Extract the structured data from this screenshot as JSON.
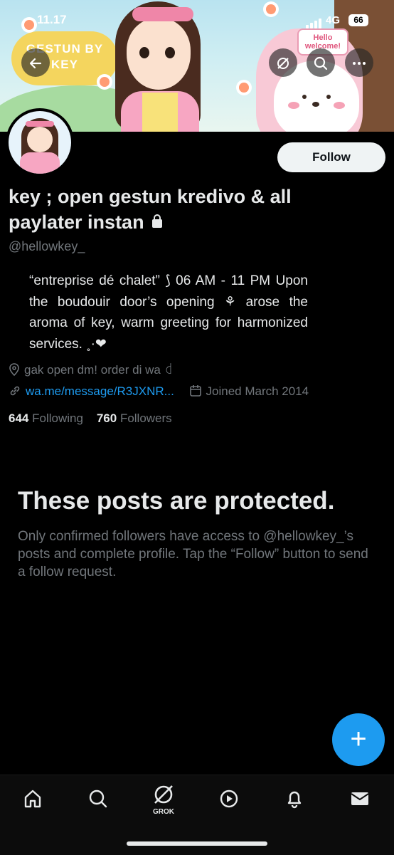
{
  "status_bar": {
    "time": "11.17",
    "network": "4G",
    "battery": "66"
  },
  "banner": {
    "logo_text": "GESTUN BY KEY",
    "sign_text": "Hello welcome!"
  },
  "header": {
    "back_icon": "arrow-left-icon",
    "grok_icon": "grok-icon",
    "search_icon": "search-icon",
    "more_icon": "more-horizontal-icon"
  },
  "profile": {
    "follow_label": "Follow",
    "display_name": "key ; open gestun kredivo & all paylater instan",
    "handle": "@hellowkey_",
    "bio": "“entreprise dé chalet” ⟆ 06 AM  -  11 PM Upon the boudouir door’s opening ⚘ arose the aroma of key, warm greeting for harmonized services. ˳·❤",
    "location": "gak open dm! order di wa ꒯",
    "link": "wa.me/message/R3JXNR...",
    "joined": "Joined March 2014",
    "following_count": "644",
    "following_label": "Following",
    "followers_count": "760",
    "followers_label": "Followers"
  },
  "protected": {
    "title": "These posts are protected.",
    "description": "Only confirmed followers have access to @hellowkey_’s posts and complete profile. Tap the “Follow” button to send a follow request."
  },
  "fab": {
    "label": "+"
  },
  "bottom_nav": {
    "grok_label": "GROK"
  },
  "colors": {
    "accent": "#1d9bf0",
    "background": "#000000",
    "secondary_text": "#71767b"
  }
}
